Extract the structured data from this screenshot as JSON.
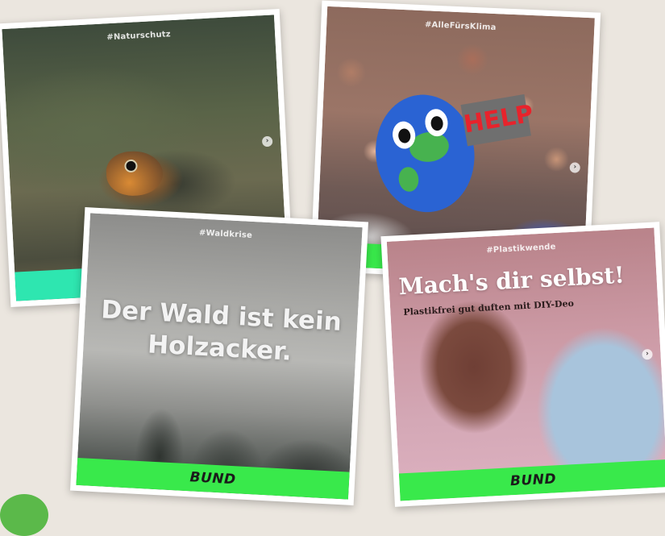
{
  "cards": [
    {
      "hashtag": "#Naturschutz",
      "next_icon": "›"
    },
    {
      "hashtag": "#AlleFürsKlima",
      "sign_text": "HELP",
      "next_icon": "›"
    },
    {
      "hashtag": "#Waldkrise",
      "headline_line1": "Der Wald ist kein",
      "headline_line2": "Holzacker.",
      "brand": "BUND"
    },
    {
      "hashtag": "#Plastikwende",
      "headline": "Mach's dir selbst!",
      "subline": "Plastikfrei gut duften mit DIY-Deo",
      "brand": "BUND",
      "next_icon": "›"
    }
  ],
  "colors": {
    "brand_green": "#39e94b",
    "teal_bar": "#2ee6b0",
    "background": "#ebe6df"
  }
}
